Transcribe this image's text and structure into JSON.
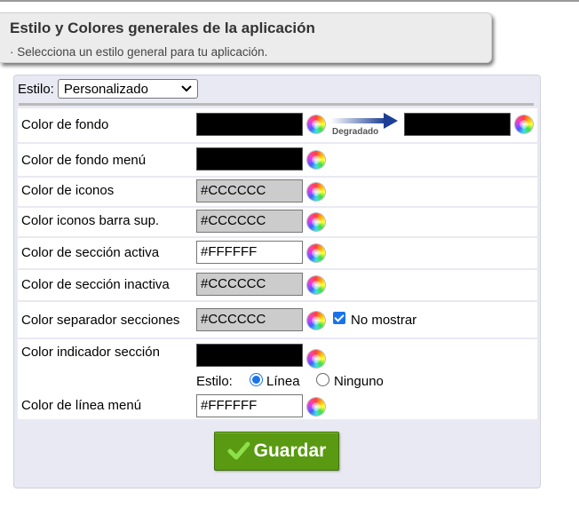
{
  "header": {
    "title": "Estilo y Colores generales de la aplicación",
    "subtitle": "· Selecciona un estilo general para tu aplicación."
  },
  "style_selector": {
    "label": "Estilo:",
    "selected": "Personalizado"
  },
  "rows": [
    {
      "label": "Color de fondo",
      "value": "",
      "color": "#000000"
    },
    {
      "label": "Color de fondo menú",
      "value": "",
      "color": "#000000"
    },
    {
      "label": "Color de iconos",
      "value": "#CCCCCC",
      "color": "#CCCCCC"
    },
    {
      "label": "Color iconos barra sup.",
      "value": "#CCCCCC",
      "color": "#CCCCCC"
    },
    {
      "label": "Color de sección activa",
      "value": "#FFFFFF",
      "color": "#FFFFFF"
    },
    {
      "label": "Color de sección inactiva",
      "value": "#CCCCCC",
      "color": "#CCCCCC"
    },
    {
      "label": "Color separador secciones",
      "value": "#CCCCCC",
      "color": "#CCCCCC"
    },
    {
      "label": "Color indicador sección",
      "value": "",
      "color": "#000000"
    },
    {
      "label": "Color de línea menú",
      "value": "#FFFFFF",
      "color": "#FFFFFF"
    }
  ],
  "gradient": {
    "label": "Degradado",
    "end_value": "",
    "end_color": "#000000"
  },
  "no_mostrar": {
    "label": "No mostrar",
    "checked": true
  },
  "indicator_style": {
    "label": "Estilo:",
    "options": [
      "Línea",
      "Ninguno"
    ],
    "selected": "Línea"
  },
  "save_button": {
    "label": "Guardar"
  },
  "colors": {
    "accent_blue": "#1a73e8",
    "save_green": "#5a9a12",
    "panel_bg": "#e9e9f3"
  }
}
